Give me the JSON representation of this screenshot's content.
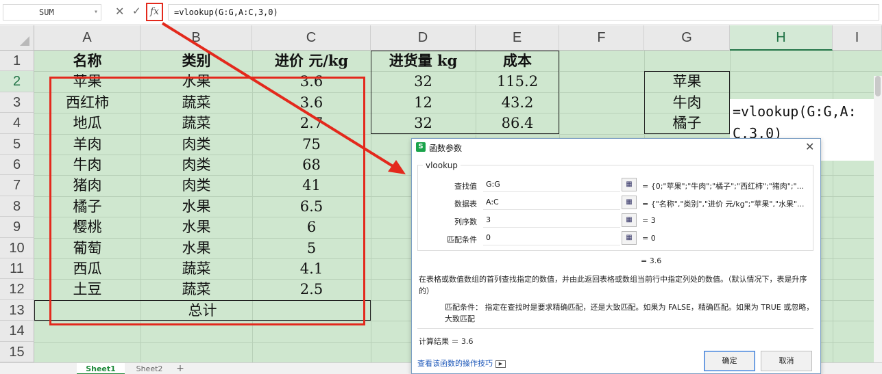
{
  "formula_bar": {
    "name_box": "SUM",
    "cancel_symbol": "✕",
    "enter_symbol": "✓",
    "fx_label": "fx",
    "formula": "=vlookup(G:G,A:C,3,0)"
  },
  "columns": [
    "A",
    "B",
    "C",
    "D",
    "E",
    "F",
    "G",
    "H",
    "I"
  ],
  "selected_column": "H",
  "rows": [
    "1",
    "2",
    "3",
    "4",
    "5",
    "6",
    "7",
    "8",
    "9",
    "10",
    "11",
    "12",
    "13",
    "14",
    "15"
  ],
  "selected_row": "2",
  "table": {
    "headers": [
      "名称",
      "类别",
      "进价 元/kg",
      "进货量 kg",
      "成本"
    ],
    "rows": [
      [
        "苹果",
        "水果",
        "3.6",
        "32",
        "115.2"
      ],
      [
        "西红柿",
        "蔬菜",
        "3.6",
        "12",
        "43.2"
      ],
      [
        "地瓜",
        "蔬菜",
        "2.7",
        "32",
        "86.4"
      ],
      [
        "羊肉",
        "肉类",
        "75",
        "",
        ""
      ],
      [
        "牛肉",
        "肉类",
        "68",
        "",
        ""
      ],
      [
        "猪肉",
        "肉类",
        "41",
        "",
        ""
      ],
      [
        "橘子",
        "水果",
        "6.5",
        "",
        ""
      ],
      [
        "樱桃",
        "水果",
        "6",
        "",
        ""
      ],
      [
        "葡萄",
        "水果",
        "5",
        "",
        ""
      ],
      [
        "西瓜",
        "蔬菜",
        "4.1",
        "",
        ""
      ],
      [
        "土豆",
        "蔬菜",
        "2.5",
        "",
        ""
      ]
    ],
    "total_label": "总计"
  },
  "lookup_values": [
    "苹果",
    "牛肉",
    "橘子"
  ],
  "cell_editor": "=vlookup(G:G,A:C,3,0)",
  "sheet_tabs": {
    "tabs": [
      "Sheet1",
      "Sheet2"
    ],
    "active": "Sheet1",
    "add_symbol": "+"
  },
  "dialog": {
    "title": "函数参数",
    "logo": "S",
    "close_symbol": "✕",
    "function_name": "vlookup",
    "params": [
      {
        "label": "查找值",
        "value": "G:G",
        "result": "= {0;\"苹果\";\"牛肉\";\"橘子\";\"西红柿\";\"猪肉\";\"..."
      },
      {
        "label": "数据表",
        "value": "A:C",
        "result": "= {\"名称\",\"类别\",\"进价 元/kg\";\"苹果\",\"水果\"..."
      },
      {
        "label": "列序数",
        "value": "3",
        "result": "= 3"
      },
      {
        "label": "匹配条件",
        "value": "0",
        "result": "= 0"
      }
    ],
    "result_line": "= 3.6",
    "description": "在表格或数值数组的首列查找指定的数值，并由此返回表格或数组当前行中指定列处的数值。（默认情况下，表是升序的）",
    "match_help": "匹配条件：  指定在查找时是要求精确匹配，还是大致匹配。如果为 FALSE，精确匹配。如果为 TRUE 或忽略，大致匹配",
    "calc_result": "计算结果 ＝ 3.6",
    "help_link": "查看该函数的操作技巧",
    "ok_label": "确定",
    "cancel_label": "取消"
  },
  "colors": {
    "grid_bg": "#cfe7cf",
    "highlight_red": "#e3291c",
    "accent_green": "#217346",
    "link_blue": "#1a55b8"
  }
}
